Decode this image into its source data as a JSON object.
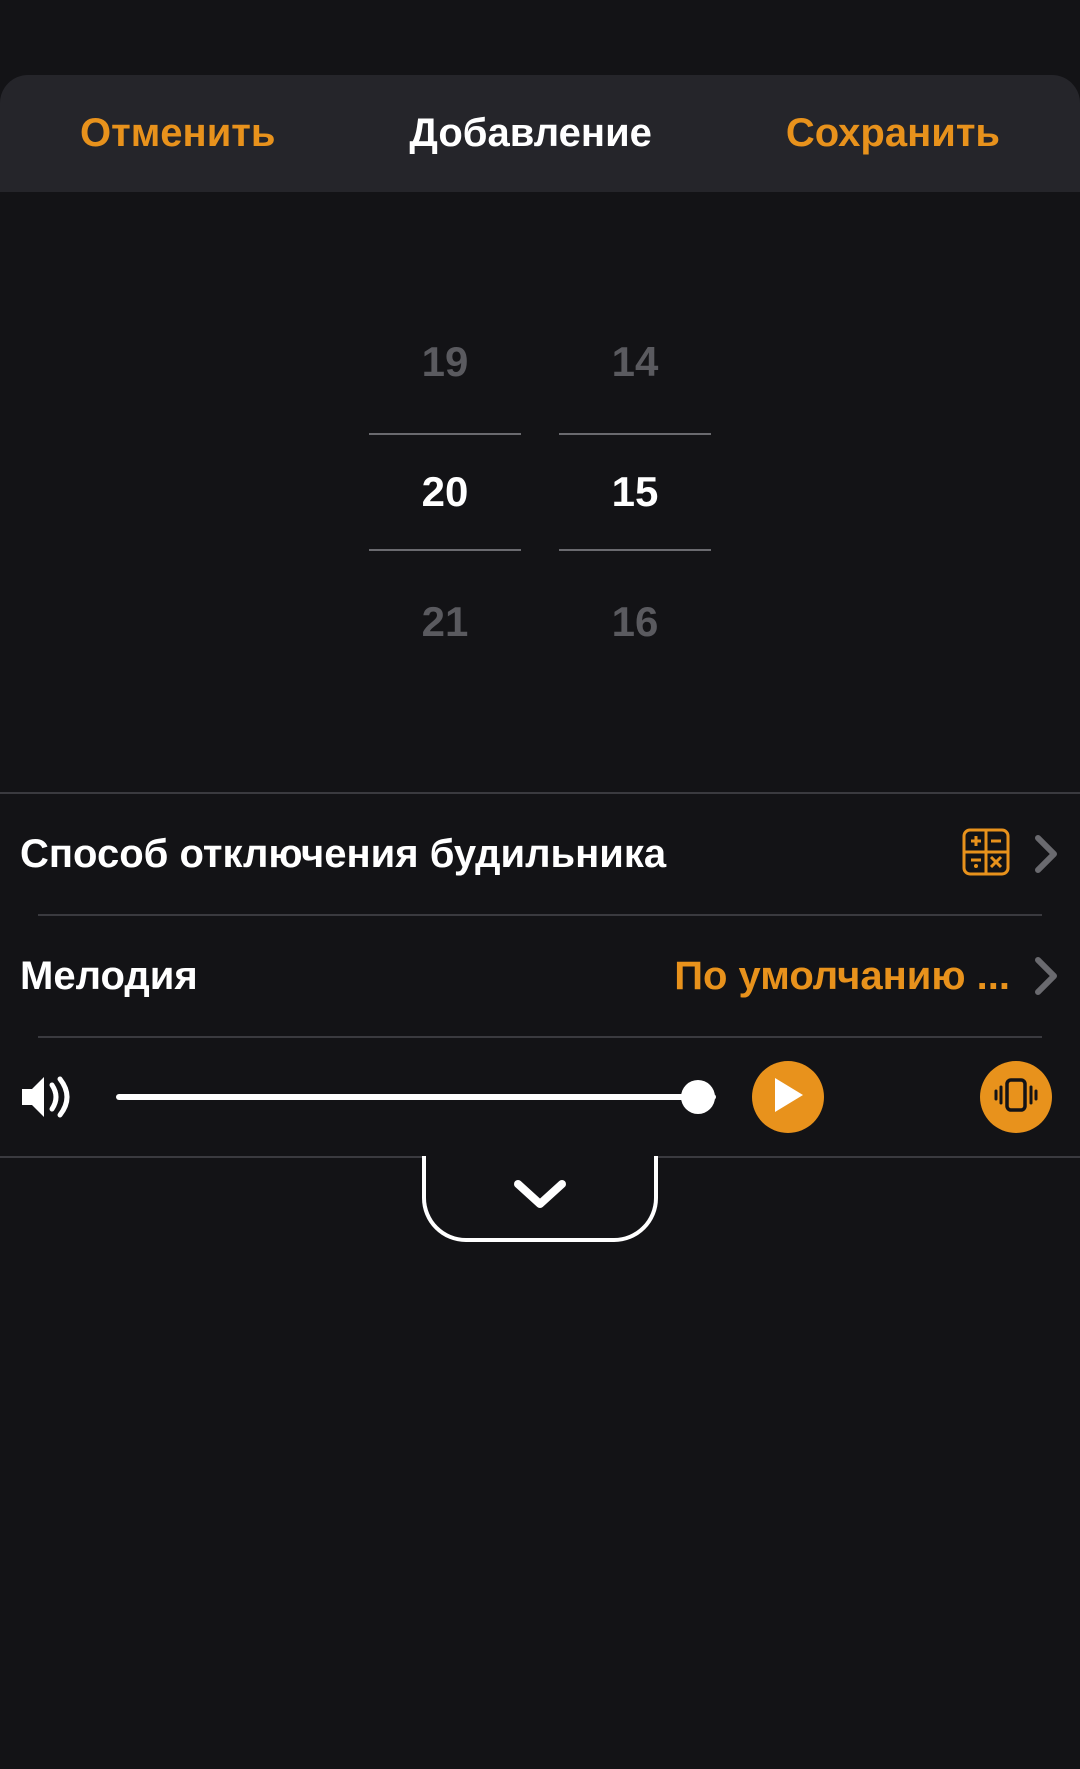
{
  "header": {
    "cancel": "Отменить",
    "title": "Добавление",
    "save": "Сохранить"
  },
  "time_picker": {
    "hours": {
      "prev": "19",
      "selected": "20",
      "next": "21"
    },
    "minutes": {
      "prev": "14",
      "selected": "15",
      "next": "16"
    }
  },
  "settings": {
    "disable_method": {
      "label": "Способ отключения будильника",
      "value_icon": "math-grid-icon"
    },
    "melody": {
      "label": "Мелодия",
      "value": "По умолчанию ..."
    }
  },
  "volume": {
    "percent": 97
  },
  "icons": {
    "chevron_right": "chevron-right-icon",
    "chevron_down": "chevron-down-icon",
    "speaker": "speaker-icon",
    "play": "play-icon",
    "vibrate": "vibrate-icon"
  },
  "colors": {
    "accent": "#e8921c",
    "background": "#131316",
    "header_bg": "#25252a"
  }
}
